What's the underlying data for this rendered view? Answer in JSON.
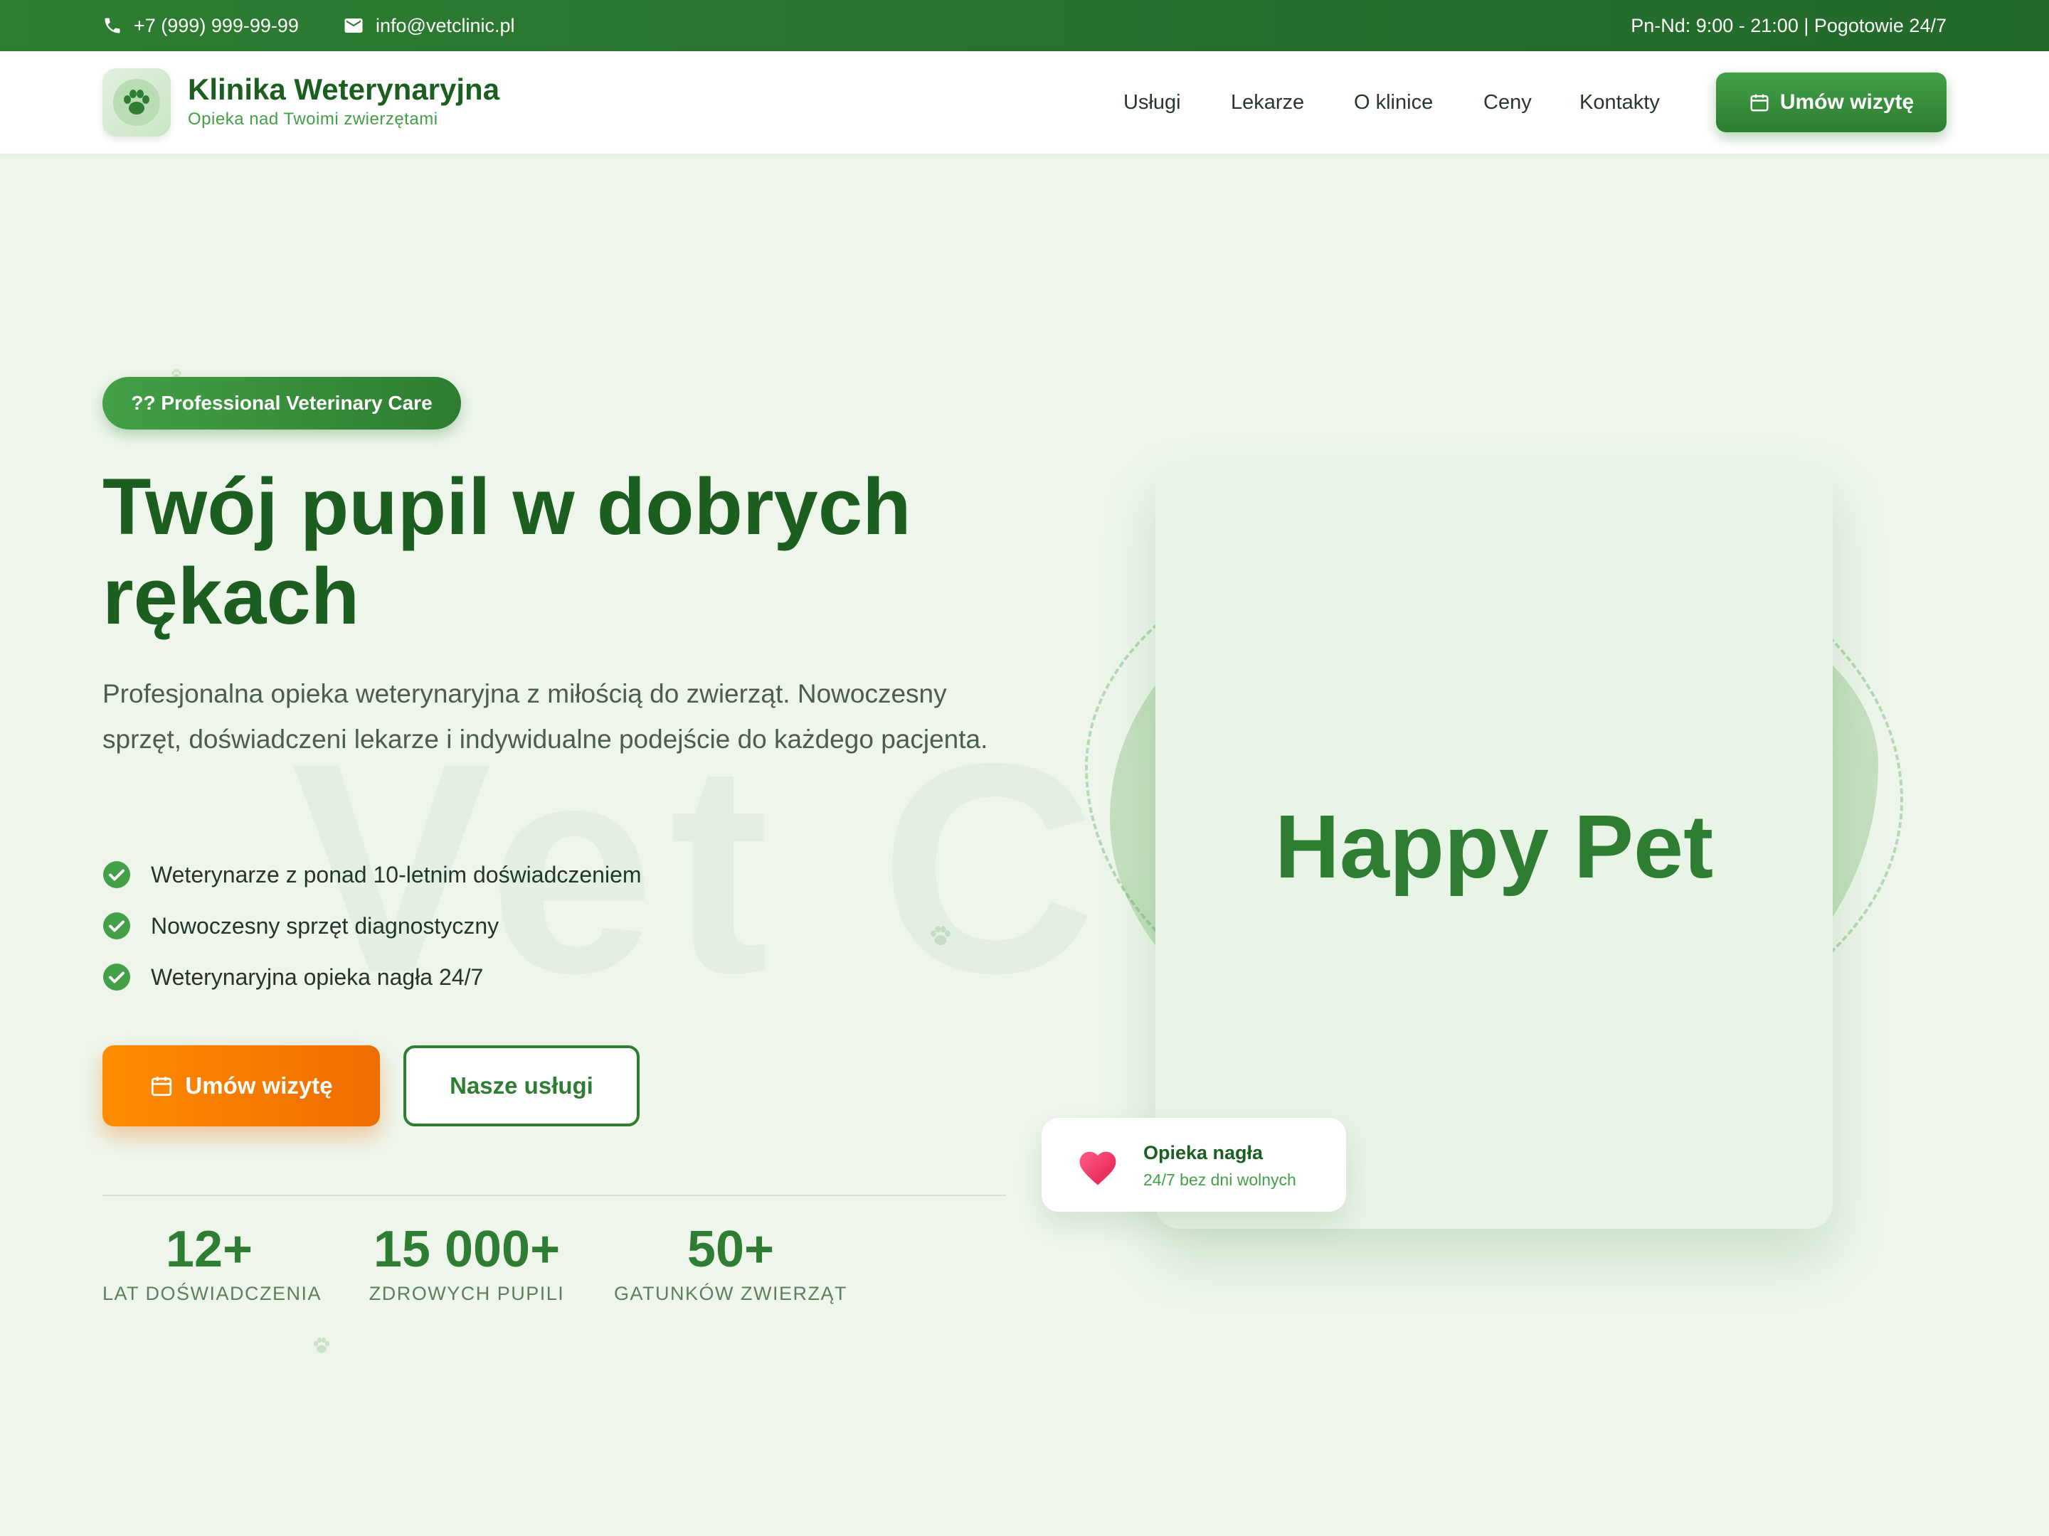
{
  "topbar": {
    "phone": "+7 (999) 999-99-99",
    "email": "info@vetclinic.pl",
    "hours": "Pn-Nd: 9:00 - 21:00 | Pogotowie 24/7"
  },
  "brand": {
    "title": "Klinika Weterynaryjna",
    "subtitle": "Opieka nad Twoimi zwierzętami",
    "logo_icon": "paw-icon"
  },
  "nav": {
    "items": [
      "Usługi",
      "Lekarze",
      "O klinice",
      "Ceny",
      "Kontakty"
    ],
    "cta": "Umów wizytę"
  },
  "hero": {
    "badge": "?? Professional Veterinary Care",
    "title": "Twój pupil w dobrych rękach",
    "description": "Profesjonalna opieka weterynaryjna z miłością do zwierząt. Nowoczesny sprzęt, doświadczeni lekarze i indywidualne podejście do każdego pacjenta.",
    "features": [
      "Weterynarze z ponad 10-letnim doświadczeniem",
      "Nowoczesny sprzęt diagnostyczny",
      "Weterynaryjna opieka nagła 24/7"
    ],
    "primary_button": "Umów wizytę",
    "secondary_button": "Nasze usługi",
    "watermark": "Vet C"
  },
  "stats": [
    {
      "value": "12+",
      "label": "LAT DOŚWIADCZENIA"
    },
    {
      "value": "15 000+",
      "label": "ZDROWYCH PUPILI"
    },
    {
      "value": "50+",
      "label": "GATUNKÓW ZWIERZĄT"
    }
  ],
  "illustration": {
    "card_text": "Happy Pet",
    "floating_title": "Opieka nagła",
    "floating_subtitle": "24/7 bez dni wolnych",
    "floating_icon": "heart-icon"
  },
  "colors": {
    "primary_green": "#2e7d32",
    "dark_green": "#1b5e20",
    "accent_orange": "#ef6c00",
    "background": "#eef6ec"
  }
}
